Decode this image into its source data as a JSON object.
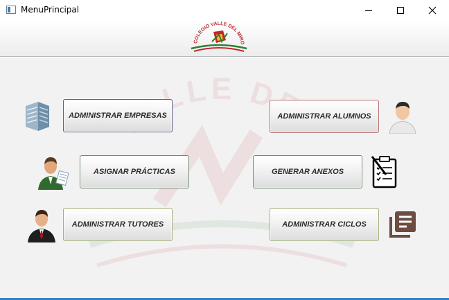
{
  "window": {
    "title": "MenuPrincipal"
  },
  "header": {
    "logo_text": "COLEGIO VALLE DEL MIRO"
  },
  "menu": {
    "administrar_empresas": "ADMINISTRAR EMPRESAS",
    "administrar_alumnos": "ADMINISTRAR ALUMNOS",
    "asignar_practicas": "ASIGNAR PRÁCTICAS",
    "generar_anexos": "GENERAR ANEXOS",
    "administrar_tutores": "ADMINISTRAR TUTORES",
    "administrar_ciclos": "ADMINISTRAR CICLOS"
  },
  "icons": {
    "empresas": "building-icon",
    "alumnos": "student-icon",
    "practicas": "worker-icon",
    "anexos": "clipboard-icon",
    "tutores": "tutor-icon",
    "ciclos": "books-icon"
  },
  "colors": {
    "logo_red": "#c0272d",
    "logo_green": "#2e7d32",
    "taskbar_accent": "#3b7fc2"
  }
}
